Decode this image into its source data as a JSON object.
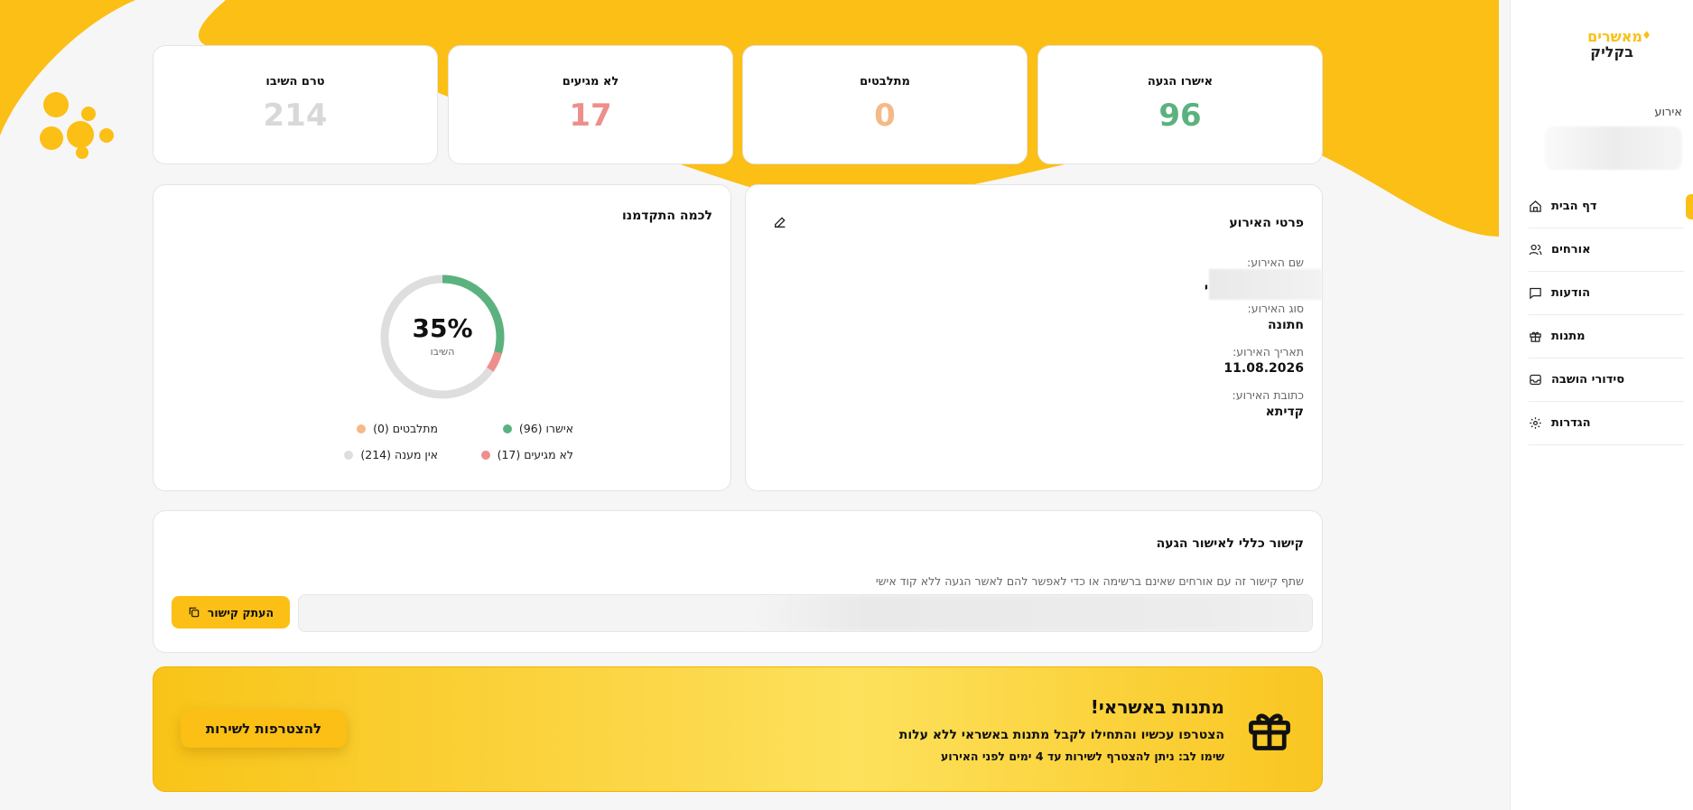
{
  "brand": {
    "line1": "מאשרים",
    "line2": "בקליק",
    "color": "#fbbf15"
  },
  "sidebar": {
    "event_label": "אירוע",
    "items": [
      {
        "label": "דף הבית",
        "icon": "home-icon",
        "active": true
      },
      {
        "label": "אורחים",
        "icon": "users-icon",
        "active": false
      },
      {
        "label": "הודעות",
        "icon": "message-icon",
        "active": false
      },
      {
        "label": "מתנות",
        "icon": "gift-icon",
        "active": false
      },
      {
        "label": "סידורי הושבה",
        "icon": "inbox-icon",
        "active": false
      },
      {
        "label": "הגדרות",
        "icon": "gear-icon",
        "active": false
      }
    ]
  },
  "stats": [
    {
      "title": "אישרו הגעה",
      "value": "96",
      "color": "#5bb27f"
    },
    {
      "title": "מתלבטים",
      "value": "0",
      "color": "#f5b987"
    },
    {
      "title": "לא מגיעים",
      "value": "17",
      "color": "#ee8f8b"
    },
    {
      "title": "טרם השיבו",
      "value": "214",
      "color": "#d8d8d8"
    }
  ],
  "event_details": {
    "title": "פרטי האירוע",
    "name_label": "שם האירוע:",
    "name_value": "י",
    "type_label": "סוג האירוע:",
    "type_value": "חתונה",
    "date_label": "תאריך האירוע:",
    "date_value": "11.08.2026",
    "address_label": "כתובת האירוע:",
    "address_value": "קדיתא"
  },
  "progress": {
    "title": "לכמה התקדמנו",
    "percent_text": "35%",
    "sub": "השיבו",
    "segments": {
      "confirmed": 96,
      "maybe": 0,
      "declined": 17,
      "no_answer": 214
    },
    "legend": {
      "confirmed": "אישרו (96)",
      "maybe": "מתלבטים (0)",
      "declined": "לא מגיעים (17)",
      "no_answer": "אין מענה (214)"
    },
    "colors": {
      "confirmed": "#5bb27f",
      "maybe": "#f5b987",
      "declined": "#ee8f8b",
      "no_answer": "#dedede"
    }
  },
  "rsvp_link": {
    "title": "קישור כללי לאישור הגעה",
    "description": "שתף קישור זה עם אורחים שאינם ברשימה או כדי לאפשר להם לאשר הגעה ללא קוד אישי",
    "copy_label": "העתק קישור"
  },
  "banner": {
    "title": "מתנות באשראי!",
    "line1": "הצטרפו עכשיו והתחילו לקבל מתנות באשראי ללא עלות",
    "line2": "שימו לב: ניתן להצטרף לשירות עד 4 ימים לפני האירוע",
    "button": "להצטרפות לשירות"
  }
}
